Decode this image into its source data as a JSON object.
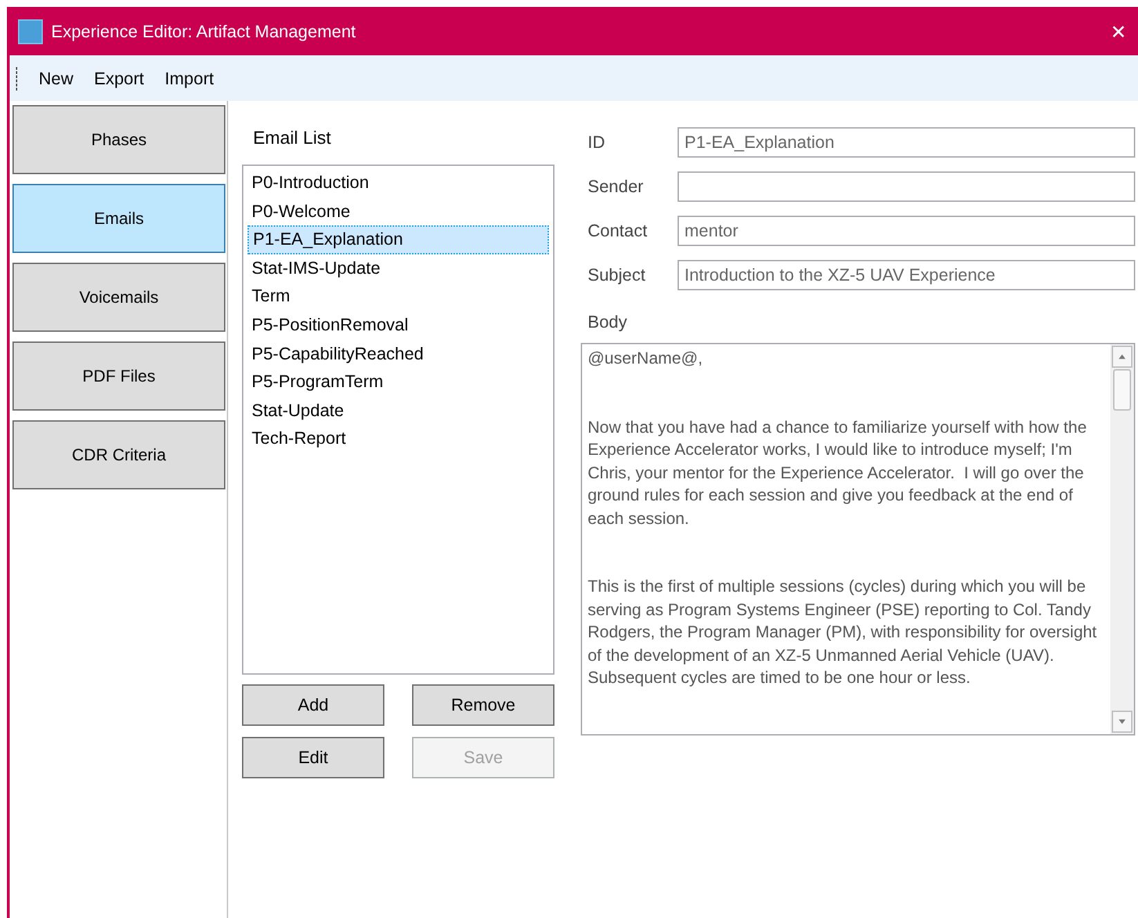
{
  "window": {
    "title": "Experience Editor: Artifact Management",
    "close": "✕"
  },
  "menu": [
    "New",
    "Export",
    "Import"
  ],
  "nav": [
    {
      "label": "Phases",
      "selected": false
    },
    {
      "label": "Emails",
      "selected": true
    },
    {
      "label": "Voicemails",
      "selected": false
    },
    {
      "label": "PDF Files",
      "selected": false
    },
    {
      "label": "CDR Criteria",
      "selected": false
    }
  ],
  "list": {
    "heading": "Email List",
    "items": [
      {
        "label": "P0-Introduction",
        "selected": false
      },
      {
        "label": "P0-Welcome",
        "selected": false
      },
      {
        "label": "P1-EA_Explanation",
        "selected": true
      },
      {
        "label": "Stat-IMS-Update",
        "selected": false
      },
      {
        "label": "Term",
        "selected": false
      },
      {
        "label": "P5-PositionRemoval",
        "selected": false
      },
      {
        "label": "P5-CapabilityReached",
        "selected": false
      },
      {
        "label": "P5-ProgramTerm",
        "selected": false
      },
      {
        "label": "Stat-Update",
        "selected": false
      },
      {
        "label": "Tech-Report",
        "selected": false
      }
    ]
  },
  "buttons": [
    {
      "label": "Add",
      "disabled": false
    },
    {
      "label": "Remove",
      "disabled": false
    },
    {
      "label": "Edit",
      "disabled": false
    },
    {
      "label": "Save",
      "disabled": true
    }
  ],
  "fields": [
    {
      "label": "ID",
      "value": "P1-EA_Explanation"
    },
    {
      "label": "Sender"
    },
    {
      "label": "Contact",
      "value": "mentor"
    },
    {
      "label": "Subject",
      "value": "Introduction to the XZ-5 UAV Experience"
    }
  ],
  "body": {
    "label": "Body",
    "value": "@userName@,\n\n\nNow that you have had a chance to familiarize yourself with how the Experience Accelerator works, I would like to introduce myself; I'm Chris, your mentor for the Experience Accelerator.  I will go over the ground rules for each session and give you feedback at the end of each session.\n\n\nThis is the first of multiple sessions (cycles) during which you will be serving as Program Systems Engineer (PSE) reporting to Col. Tandy Rodgers, the Program Manager (PM), with responsibility for oversight of the development of an XZ-5 Unmanned Aerial Vehicle (UAV). Subsequent cycles are timed to be one hour or less."
  }
}
